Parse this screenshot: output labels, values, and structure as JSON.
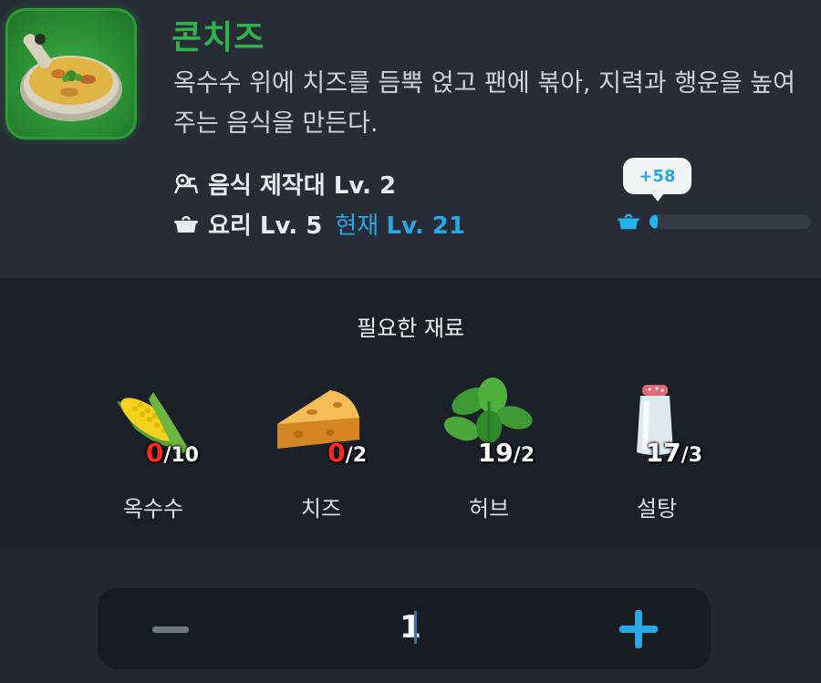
{
  "recipe": {
    "name": "콘치즈",
    "description": "옥수수 위에 치즈를 듬뿍 얹고 팬에 볶아, 지력과 행운을 높여주는 음식을 만든다.",
    "icon": "corn-cheese-pan-icon",
    "station_requirement": "음식 제작대 Lv. 2",
    "skill_requirement": "요리 Lv. 5",
    "current_level_label": "현재",
    "current_level_value": "Lv. 21"
  },
  "xp": {
    "gain": "+58",
    "fill_fraction": 0.05,
    "icon": "cooking-pot-icon"
  },
  "materials": {
    "title": "필요한 재료",
    "items": [
      {
        "name": "옥수수",
        "have": "0",
        "need": "/10",
        "icon": "corn-icon",
        "sufficient": false
      },
      {
        "name": "치즈",
        "have": "0",
        "need": "/2",
        "icon": "cheese-icon",
        "sufficient": false
      },
      {
        "name": "허브",
        "have": "19",
        "need": "/2",
        "icon": "herb-icon",
        "sufficient": true
      },
      {
        "name": "설탕",
        "have": "17",
        "need": "/3",
        "icon": "sugar-icon",
        "sufficient": true
      }
    ]
  },
  "quantity": {
    "value": "1",
    "minus_icon": "minus-icon",
    "plus_icon": "plus-icon"
  },
  "colors": {
    "title_green": "#2fb24c",
    "accent_blue": "#24b3ec",
    "insufficient_red": "#ff2a1a"
  }
}
